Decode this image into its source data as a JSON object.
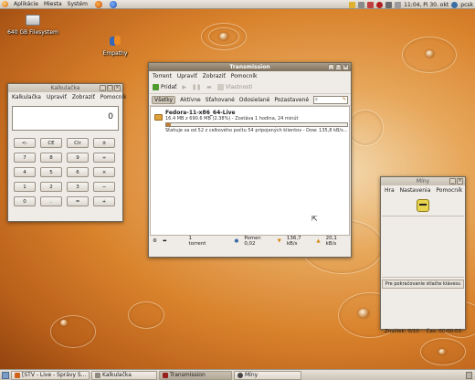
{
  "top_panel": {
    "menus": [
      "Aplikácie",
      "Miesta",
      "Systém"
    ],
    "clock": "11:04, Pi 30. okt",
    "user": "pcsk"
  },
  "desktop": {
    "icons": [
      {
        "label": "640 GB Filesystem",
        "icon": "harddisk-icon"
      },
      {
        "label": "Empathy",
        "icon": "empathy-icon"
      }
    ]
  },
  "calculator": {
    "title": "Kalkulačka",
    "menus": [
      "Kalkulačka",
      "Upraviť",
      "Zobraziť",
      "Pomocník"
    ],
    "display": "0",
    "keys": [
      "<-",
      "CE",
      "Clr",
      "±",
      "7",
      "8",
      "9",
      "÷",
      "4",
      "5",
      "6",
      "×",
      "1",
      "2",
      "3",
      "−",
      "0",
      ".",
      "=",
      "+"
    ]
  },
  "transmission": {
    "title": "Transmission",
    "menus": [
      "Torrent",
      "Upraviť",
      "Zobraziť",
      "Pomocník"
    ],
    "toolbar": {
      "add_label": "Pridať",
      "properties_label": "Vlastnosti"
    },
    "filters": [
      "Všetky",
      "Aktívne",
      "Sťahované",
      "Odosielané",
      "Pozastavené"
    ],
    "torrent": {
      "name": "Fedora-11-x86_64-Live",
      "size_line": "16.4 MB z 690.6 MB (2.38%) - Zostáva 1 hodina, 24 minút",
      "progress": 0.0238,
      "status_line": "Sťahuje sa od 52 z celkového počtu 54 pripojených klientov - Dow: 135,8 kB/s..."
    },
    "status": {
      "count": "1 torrent",
      "ratio": "Pomer: 0,02",
      "down": "136,7 kB/s",
      "up": "20,1 kB/s"
    }
  },
  "mines": {
    "title": "Míny",
    "menus": [
      "Hra",
      "Nastavenia",
      "Pomocník"
    ],
    "message": "Pre pokračovanie stlačte klávesu",
    "mines_label": "Značiek: 0/10",
    "time_label": "Čas: 00:00:03"
  },
  "taskbar": {
    "tasks": [
      "[STV - Live - Správy S...",
      "Kalkulačka",
      "Transmission",
      "Míny"
    ]
  },
  "colors": {
    "accent": "#c27c2e",
    "titlebar": "#8d816e"
  }
}
